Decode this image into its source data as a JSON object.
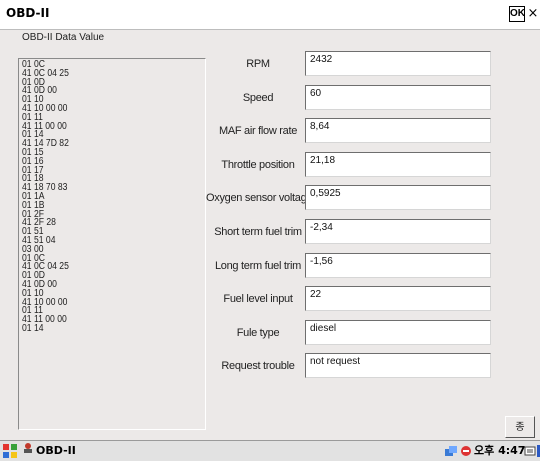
{
  "window": {
    "title": "OBD-II",
    "ok_label": "OK",
    "close_label": "×"
  },
  "group_label": "OBD-II Data Value",
  "log_lines": [
    "01 0C",
    "41 0C 04 25",
    "01 0D",
    "41 0D 00",
    "01 10",
    "41 10 00 00",
    "01 11",
    "41 11 00 00",
    "01 14",
    "41 14 7D 82",
    "01 15",
    "01 16",
    "01 17",
    "01 18",
    "41 18 70 83",
    "01 1A",
    "01 1B",
    "01 2F",
    "41 2F 28",
    "01 51",
    "41 51 04",
    "03 00",
    "01 0C",
    "41 0C 04 25",
    "01 0D",
    "41 0D 00",
    "01 10",
    "41 10 00 00",
    "01 11",
    "41 11 00 00",
    "01 14"
  ],
  "rows": [
    {
      "label": "RPM",
      "value": "2432"
    },
    {
      "label": "Speed",
      "value": "60"
    },
    {
      "label": "MAF air flow rate",
      "value": "8,64"
    },
    {
      "label": "Throttle position",
      "value": "21,18"
    },
    {
      "label": "Oxygen sensor voltage",
      "value": "0,5925"
    },
    {
      "label": "Short term fuel trim",
      "value": "-2,34"
    },
    {
      "label": "Long term fuel trim",
      "value": "-1,56"
    },
    {
      "label": "Fuel level input",
      "value": "22"
    },
    {
      "label": "Fule type",
      "value": "diesel"
    },
    {
      "label": "Request trouble",
      "value": "not request"
    }
  ],
  "exit_button_label": "종료",
  "taskbar": {
    "app_label": "OBD-II",
    "clock": "오후 4:47"
  },
  "colors": {
    "client_bg": "#ece9e8",
    "field_bg": "#ffffff",
    "tray_accent": "#2b59c3"
  }
}
